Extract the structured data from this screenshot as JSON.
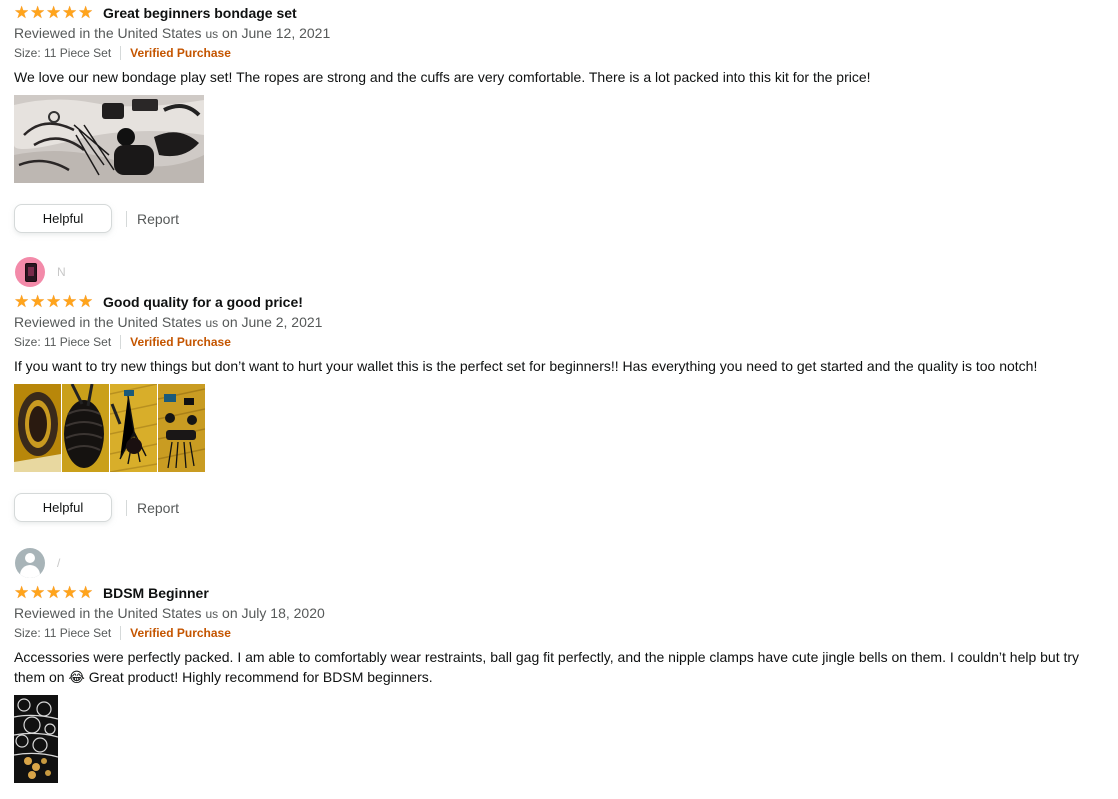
{
  "reviews": [
    {
      "profile_name": "",
      "title": "Great beginners bondage set",
      "reviewed_prefix": "Reviewed in the United States",
      "country_code": "us",
      "date_text": "on June 12, 2021",
      "size": "Size: 11 Piece Set",
      "verified": "Verified Purchase",
      "body": "We love our new bondage play set! The ropes are strong and the cuffs are very comfortable. There is a lot packed into this kit for the price!",
      "rating": 5,
      "helpful_label": "Helpful",
      "report_label": "Report"
    },
    {
      "profile_name": "N",
      "title": "Good quality for a good price!",
      "reviewed_prefix": "Reviewed in the United States",
      "country_code": "us",
      "date_text": "on June 2, 2021",
      "size": "Size: 11 Piece Set",
      "verified": "Verified Purchase",
      "body": "If you want to try new things but don’t want to hurt your wallet this is the perfect set for beginners!! Has everything you need to get started and the quality is too notch!",
      "rating": 5,
      "helpful_label": "Helpful",
      "report_label": "Report"
    },
    {
      "profile_name": "/",
      "title": "BDSM Beginner",
      "reviewed_prefix": "Reviewed in the United States",
      "country_code": "us",
      "date_text": "on July 18, 2020",
      "size": "Size: 11 Piece Set",
      "verified": "Verified Purchase",
      "body_line1": "Accessories were perfectly packed. I am able to comfortably wear restraints, ball gag fit perfectly, and the nipple clamps have cute jingle bells on them. I couldn’t help but try",
      "body_line2": "them on 😂 Great product! Highly recommend for BDSM beginners.",
      "rating": 5
    }
  ],
  "colors": {
    "star": "#ffa41c",
    "verified": "#c45500",
    "muted": "#565959",
    "text": "#0f1111"
  },
  "icons": {
    "star": "star-icon",
    "avatar_pink": "phone-avatar-icon",
    "avatar_default": "default-user-icon"
  }
}
